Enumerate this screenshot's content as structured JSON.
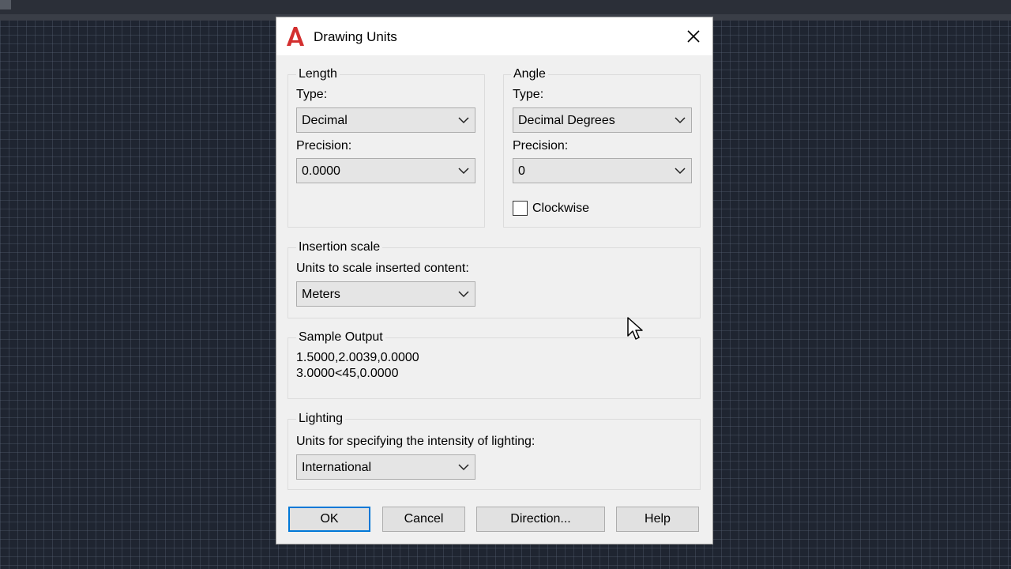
{
  "dialog": {
    "title": "Drawing Units",
    "icons": {
      "app": "autocad-logo-icon",
      "close": "close-icon"
    }
  },
  "length": {
    "legend": "Length",
    "type_label": "Type:",
    "type_value": "Decimal",
    "precision_label": "Precision:",
    "precision_value": "0.0000"
  },
  "angle": {
    "legend": "Angle",
    "type_label": "Type:",
    "type_value": "Decimal Degrees",
    "precision_label": "Precision:",
    "precision_value": "0",
    "clockwise_label": "Clockwise",
    "clockwise_checked": false
  },
  "insertion": {
    "legend": "Insertion scale",
    "units_label": "Units to scale inserted content:",
    "units_value": "Meters"
  },
  "sample": {
    "legend": "Sample Output",
    "line1": "1.5000,2.0039,0.0000",
    "line2": "3.0000<45,0.0000"
  },
  "lighting": {
    "legend": "Lighting",
    "units_label": "Units for specifying the intensity of lighting:",
    "units_value": "International"
  },
  "buttons": {
    "ok": "OK",
    "cancel": "Cancel",
    "direction": "Direction...",
    "help": "Help"
  },
  "colors": {
    "canvas": "#1f2531",
    "dialog": "#f0f0f0",
    "default_button_border": "#0078d7",
    "logo": "#d32f2f"
  }
}
